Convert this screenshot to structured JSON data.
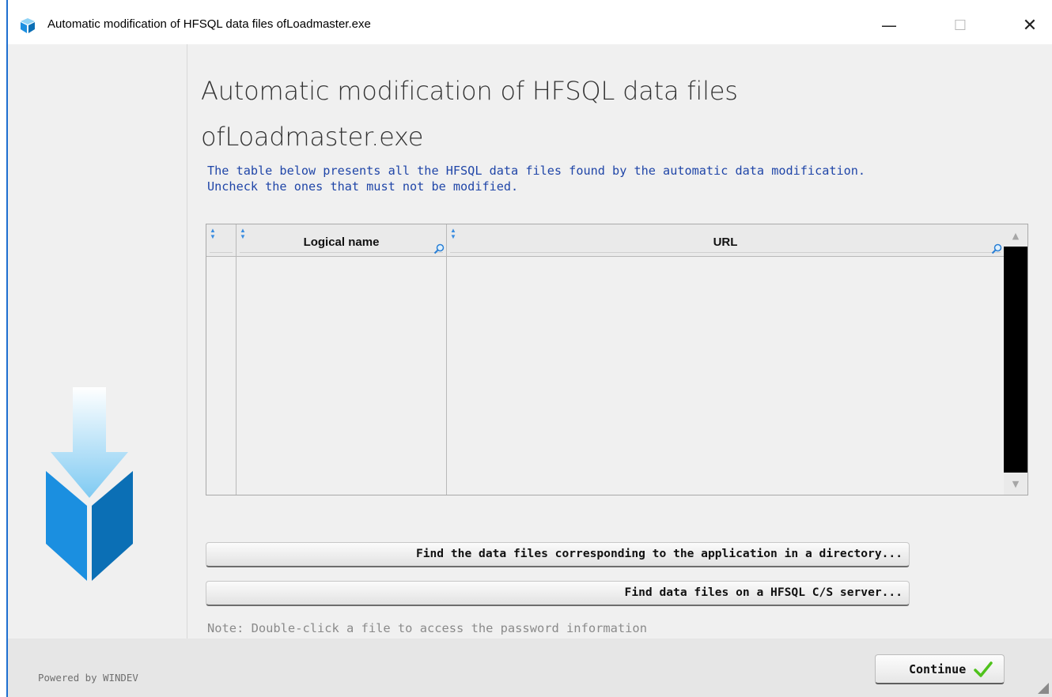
{
  "window": {
    "title": "Automatic modification of HFSQL data files ofLoadmaster.exe",
    "minimize_glyph": "—",
    "maximize_glyph": "☐",
    "close_glyph": "✕"
  },
  "heading": {
    "line1": "Automatic modification of HFSQL data files",
    "line2": "ofLoadmaster.exe"
  },
  "instructions": {
    "line1": "The table below presents all the HFSQL data files found by the automatic data modification.",
    "line2": "Uncheck the ones that must not be modified."
  },
  "table": {
    "columns": [
      {
        "label": ""
      },
      {
        "label": "Logical name"
      },
      {
        "label": "URL"
      }
    ],
    "rows": []
  },
  "buttons": {
    "find_dir": "Find the data files corresponding to the application in a directory...",
    "find_server": "Find data files on a HFSQL C/S server...",
    "continue": "Continue"
  },
  "note": "Note: Double-click a file to access the password information",
  "footer": {
    "powered_by": "Powered by WINDEV"
  },
  "icons": {
    "app": "cube-icon",
    "sidebar_art": "download-cube-icon",
    "sort": "sort-arrows-icon",
    "search": "magnifier-icon",
    "continue": "checkmark-icon"
  },
  "colors": {
    "instruction_text": "#2046a8",
    "accent_blue": "#1b8fe0",
    "check_green": "#4fc21c",
    "scrollbar_track": "#000000"
  }
}
